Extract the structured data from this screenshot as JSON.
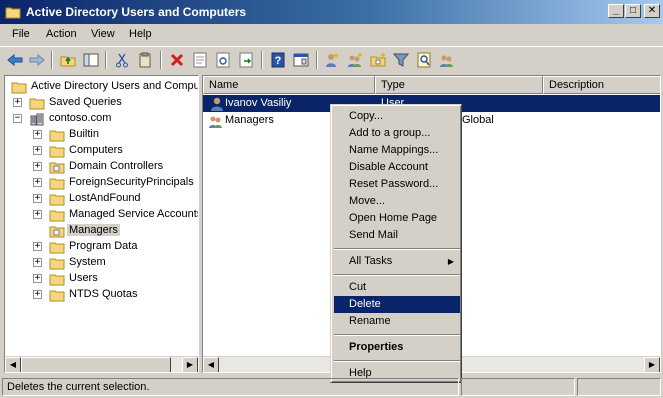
{
  "window": {
    "title": "Active Directory Users and Computers"
  },
  "menubar": {
    "items": [
      "File",
      "Action",
      "View",
      "Help"
    ]
  },
  "toolbar": {
    "buttons": [
      "back-icon",
      "forward-icon",
      "up-level-icon",
      "show-hide-tree-icon",
      "cut-icon",
      "copy-icon",
      "delete-icon",
      "properties-icon",
      "refresh-icon",
      "export-list-icon",
      "help-icon",
      "console-icon",
      "new-user-icon",
      "new-group-icon",
      "new-ou-icon",
      "filter-icon",
      "find-icon",
      "add-to-group-icon"
    ]
  },
  "tree": {
    "root": "Active Directory Users and Comput",
    "saved_queries": "Saved Queries",
    "domain": "contoso.com",
    "items": [
      "Builtin",
      "Computers",
      "Domain Controllers",
      "ForeignSecurityPrincipals",
      "LostAndFound",
      "Managed Service Accounts",
      "Managers",
      "Program Data",
      "System",
      "Users",
      "NTDS Quotas"
    ],
    "selected": "Managers"
  },
  "list": {
    "columns": [
      "Name",
      "Type",
      "Description"
    ],
    "rows": [
      {
        "name": "Ivanov Vasiliy",
        "type": "User",
        "description": ""
      },
      {
        "name": "Managers",
        "type": "Security Group - Global",
        "type_visible": "Global",
        "description": ""
      }
    ]
  },
  "context_menu": {
    "items": {
      "copy": "Copy...",
      "add_to_group": "Add to a group...",
      "name_mappings": "Name Mappings...",
      "disable_account": "Disable Account",
      "reset_password": "Reset Password...",
      "move": "Move...",
      "open_home_page": "Open Home Page",
      "send_mail": "Send Mail",
      "all_tasks": "All Tasks",
      "cut": "Cut",
      "delete": "Delete",
      "rename": "Rename",
      "properties": "Properties",
      "help": "Help"
    },
    "highlighted": "Delete"
  },
  "statusbar": {
    "text": "Deletes the current selection."
  },
  "colors": {
    "selection": "#0a246a",
    "title_start": "#0a246a",
    "title_end": "#a6caf0",
    "face": "#d4d0c8"
  }
}
